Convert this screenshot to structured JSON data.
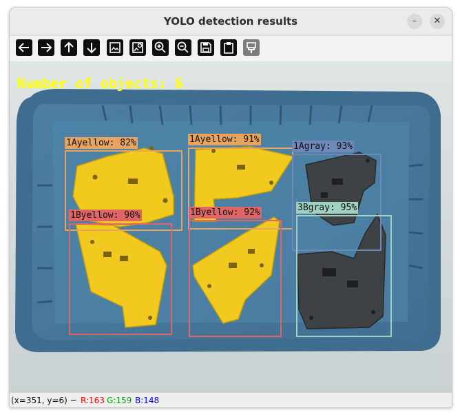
{
  "window": {
    "title": "YOLO detection results"
  },
  "toolbar": {
    "buttons": [
      {
        "name": "back-button",
        "icon": "arrow-left-icon"
      },
      {
        "name": "forward-button",
        "icon": "arrow-right-icon"
      },
      {
        "name": "up-button",
        "icon": "arrow-up-icon"
      },
      {
        "name": "down-button",
        "icon": "arrow-down-icon"
      },
      {
        "name": "image-button",
        "icon": "image-icon"
      },
      {
        "name": "image-settings-button",
        "icon": "image-settings-icon"
      },
      {
        "name": "zoom-in-button",
        "icon": "zoom-in-icon"
      },
      {
        "name": "zoom-out-button",
        "icon": "zoom-out-icon"
      },
      {
        "name": "save-button",
        "icon": "save-icon"
      },
      {
        "name": "copy-button",
        "icon": "clipboard-icon"
      },
      {
        "name": "properties-button",
        "icon": "brush-icon"
      }
    ]
  },
  "image": {
    "overlay_text": "Number of objects: 6",
    "detections": [
      {
        "label": "1Ayellow: 82%",
        "color": "#e8a45c"
      },
      {
        "label": "1Ayellow: 91%",
        "color": "#e8a45c"
      },
      {
        "label": "1Agray: 93%",
        "color": "#6e88b8"
      },
      {
        "label": "1Byellow: 90%",
        "color": "#e06565"
      },
      {
        "label": "1Byellow: 92%",
        "color": "#e06565"
      },
      {
        "label": "3Bgray: 95%",
        "color": "#9fd0c0"
      }
    ]
  },
  "status": {
    "coords": "(x=351, y=6) ~",
    "r": "R:163",
    "g": "G:159",
    "b": "B:148",
    "r_color": "#ff0000",
    "g_color": "#00aa00",
    "b_color": "#0000ff"
  }
}
